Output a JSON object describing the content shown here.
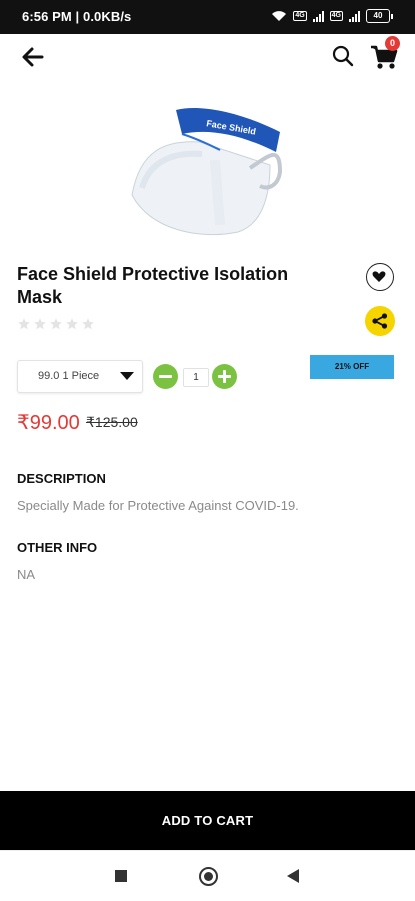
{
  "status_bar": {
    "time_and_speed": "6:56 PM | 0.0KB/s",
    "sim1": "4G",
    "sim2": "4G",
    "battery": "40"
  },
  "header": {
    "back_icon": "arrow-left-icon",
    "search_icon": "search-icon",
    "cart_icon": "shopping-cart-icon",
    "cart_count": "0"
  },
  "product": {
    "title": "Face Shield Protective Isolation Mask",
    "image_band_text": "Face Shield",
    "rating": 0,
    "max_rating": 5,
    "variant": "99.0 1 Piece",
    "quantity": "1",
    "discount": "21% OFF",
    "price": "₹99.00",
    "mrp": "₹125.00"
  },
  "description": {
    "heading": "DESCRIPTION",
    "text": "Specially Made for Protective Against COVID-19."
  },
  "other_info": {
    "heading": "OTHER INFO",
    "text": "NA"
  },
  "actions": {
    "add_to_cart": "ADD TO CART",
    "wishlist_icon": "heart-icon",
    "share_icon": "share-icon"
  },
  "colors": {
    "accent_red": "#e53935",
    "qty_green": "#7cc242",
    "share_yellow": "#f5d400",
    "discount_blue": "#3aa8e0",
    "bar_black": "#000000"
  }
}
